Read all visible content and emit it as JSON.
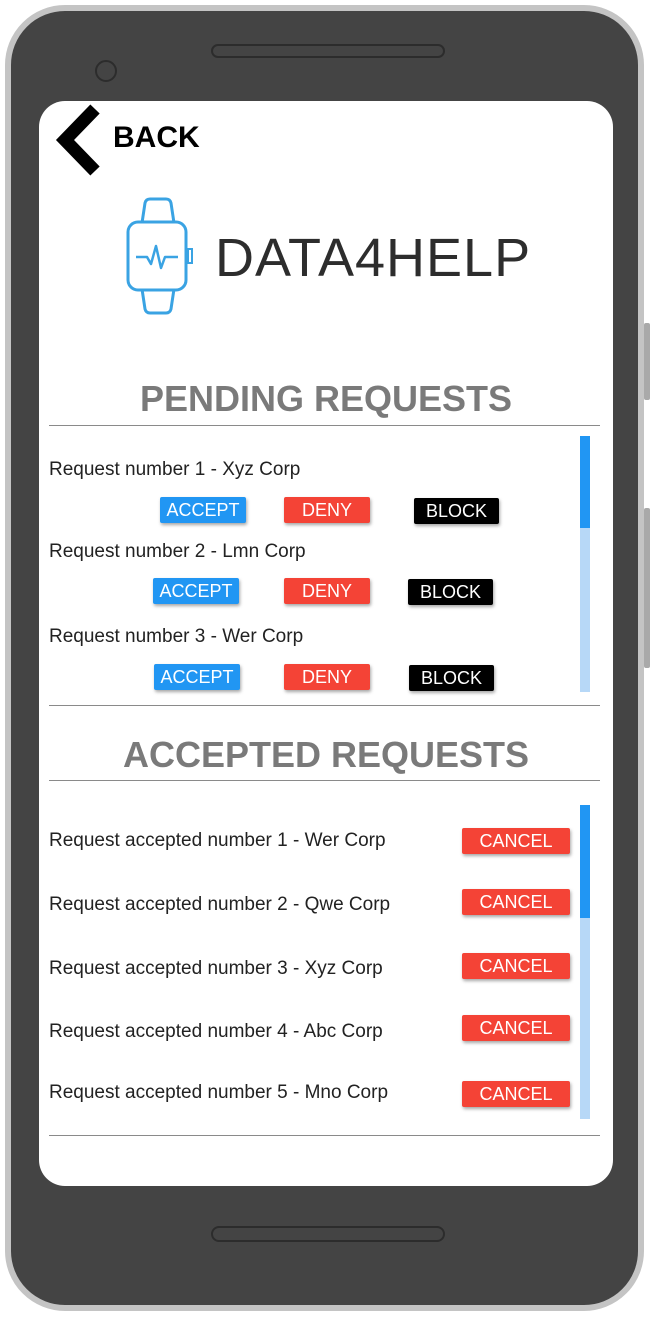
{
  "nav": {
    "back_label": "BACK"
  },
  "logo": {
    "text": "DATA4HELP"
  },
  "pending": {
    "title": "PENDING REQUESTS",
    "items": [
      {
        "label": "Request number 1 - Xyz Corp",
        "accept": "ACCEPT",
        "deny": "DENY",
        "block": "BLOCK"
      },
      {
        "label": "Request number 2 - Lmn Corp",
        "accept": "ACCEPT",
        "deny": "DENY",
        "block": "BLOCK"
      },
      {
        "label": "Request number 3 - Wer Corp",
        "accept": "ACCEPT",
        "deny": "DENY",
        "block": "BLOCK"
      }
    ]
  },
  "accepted": {
    "title": "ACCEPTED REQUESTS",
    "items": [
      {
        "label": "Request accepted number 1 - Wer Corp",
        "cancel": "CANCEL"
      },
      {
        "label": "Request accepted number 2 - Qwe Corp",
        "cancel": "CANCEL"
      },
      {
        "label": "Request accepted number 3 - Xyz Corp",
        "cancel": "CANCEL"
      },
      {
        "label": "Request accepted number 4 - Abc Corp",
        "cancel": "CANCEL"
      },
      {
        "label": "Request accepted number 5 - Mno Corp",
        "cancel": "CANCEL"
      }
    ]
  },
  "colors": {
    "accept": "#2196f3",
    "deny": "#f44336",
    "block": "#000000",
    "logo_icon": "#3aa3e3",
    "scroll_thumb": "#2196f3",
    "scroll_track": "#b7d8f7"
  },
  "icons": {
    "back": "chevron-left-icon",
    "logo": "smartwatch-heartbeat-icon"
  }
}
